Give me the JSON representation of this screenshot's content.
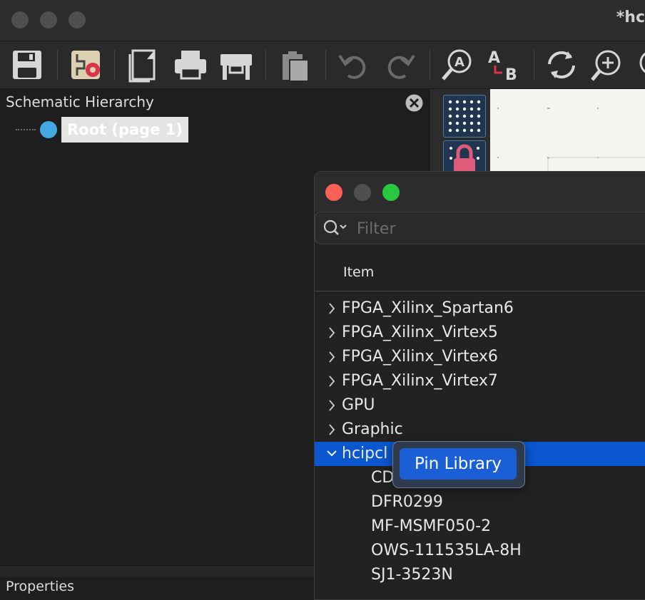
{
  "window": {
    "title": "*hc"
  },
  "toolbar": {
    "icons": [
      "save-icon",
      "schematic-setup-icon",
      "page-settings-icon",
      "print-icon",
      "plot-icon",
      "paste-icon",
      "undo-icon",
      "redo-icon",
      "find-icon",
      "find-replace-icon",
      "refresh-icon",
      "zoom-in-icon",
      "zoom-out-icon"
    ]
  },
  "hierarchy": {
    "title": "Schematic Hierarchy",
    "root_label": "Root (page 1)",
    "root_color": "#44a8e2"
  },
  "properties": {
    "label": "Properties"
  },
  "dialog": {
    "filter_placeholder": "Filter",
    "column_header": "Item",
    "items": [
      {
        "label": "FPGA_Xilinx_Spartan6",
        "expanded": false
      },
      {
        "label": "FPGA_Xilinx_Virtex5",
        "expanded": false
      },
      {
        "label": "FPGA_Xilinx_Virtex6",
        "expanded": false
      },
      {
        "label": "FPGA_Xilinx_Virtex7",
        "expanded": false
      },
      {
        "label": "GPU",
        "expanded": false
      },
      {
        "label": "Graphic",
        "expanded": false
      },
      {
        "label": "hcipcl",
        "expanded": true,
        "selected": true
      },
      {
        "label": "CD",
        "child": true
      },
      {
        "label": "DFR0299",
        "child": true
      },
      {
        "label": "MF-MSMF050-2",
        "child": true
      },
      {
        "label": "OWS-111535LA-8H",
        "child": true
      },
      {
        "label": "SJ1-3523N",
        "child": true
      }
    ]
  },
  "context_menu": {
    "item": "Pin Library"
  },
  "colors": {
    "selection": "#0a57d0",
    "menu_highlight": "#1a5fd6",
    "close_dot": "#ff5f57",
    "min_dot": "#4f4f4f",
    "zoom_dot": "#28c840"
  }
}
